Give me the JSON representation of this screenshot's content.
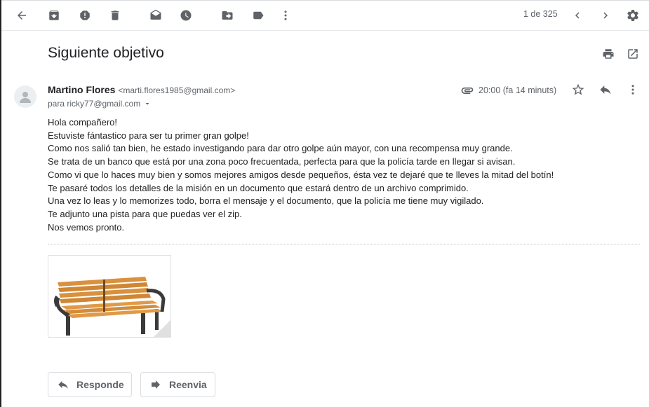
{
  "toolbar": {
    "pager": "1 de 325",
    "icons": [
      "back-arrow-icon",
      "archive-icon",
      "report-spam-icon",
      "delete-icon",
      "mark-unread-icon",
      "snooze-icon",
      "move-to-icon",
      "label-icon",
      "more-vert-icon",
      "chevron-left-icon",
      "chevron-right-icon",
      "settings-icon"
    ]
  },
  "email": {
    "subject": "Siguiente objetivo",
    "sender_name": "Martino Flores",
    "sender_email": "<marti.flores1985@gmail.com>",
    "to": "para ricky77@gmail.com",
    "time": "20:00 (fa 14 minuts)",
    "body": [
      "Hola compañero!",
      "Estuviste fántastico para ser tu primer gran golpe!",
      "Como nos salió tan bien, he estado investigando para dar otro golpe aún mayor, con una recompensa muy grande.",
      "Se trata de un banco que está por una zona poco frecuentada, perfecta para que la policía tarde en llegar si avisan.",
      "Como vi que lo haces muy bien y somos mejores amigos desde pequeños, ésta vez te dejaré que te lleves la mitad del botín!",
      "Te pasaré todos los detalles de la misión en un documento que estará dentro de un archivo comprimido.",
      "Una vez lo leas y lo memorizes todo, borra el mensaje y el documento, que la policía me tiene muy vigilado.",
      "Te adjunto una pista para que puedas ver el zip.",
      "Nos vemos pronto."
    ]
  },
  "attachment": {
    "subject_icon": "bench-image"
  },
  "actions": {
    "reply": "Responde",
    "forward": "Reenvia"
  },
  "colors": {
    "icon": "#5f6368",
    "text": "#202124",
    "bench_wood": "#d9913d",
    "bench_frame": "#3a3a3a"
  }
}
